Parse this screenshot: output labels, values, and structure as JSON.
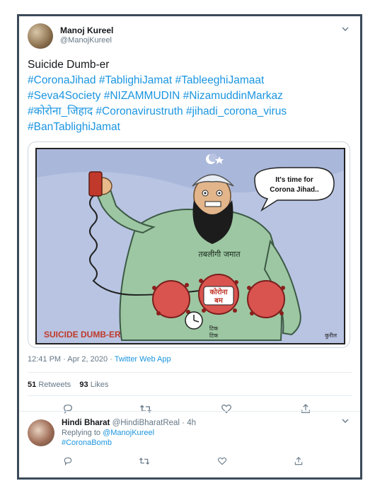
{
  "tweet": {
    "author_name": "Manoj Kureel",
    "author_handle": "@ManojKureel",
    "text_line1": "Suicide Dumb-er",
    "hashtag_lines": [
      "#CoronaJihad #TablighiJamat #TableeghiJamaat",
      "#Seva4Society #NIZAMMUDIN #NizamuddinMarkaz",
      "#कोरोना_जिहाद #Coronavirustruth #jihadi_corona_virus",
      "#BanTablighiJamat"
    ],
    "timestamp": "12:41 PM · Apr 2, 2020 · ",
    "source": "Twitter Web App",
    "retweets_count": "51",
    "retweets_label": "Retweets",
    "likes_count": "93",
    "likes_label": "Likes"
  },
  "cartoon": {
    "speech_bubble": "It's time for Corona Jihad..",
    "vest_label": "तबलीगी जमात",
    "bomb_label_line1": "कोरोना",
    "bomb_label_line2": "बम",
    "tick_line1": "टिक",
    "tick_line2": "टिक",
    "caption": "SUICIDE DUMB-ER",
    "signature": "कुरील"
  },
  "reply": {
    "author_name": "Hindi Bharat",
    "author_handle": "@HindiBharatReal · 4h",
    "replying_to_prefix": "Replying to ",
    "replying_to_handle": "@ManojKureel",
    "text": "#CoronaBomb"
  },
  "icons": [
    "chevron-down-icon",
    "reply-icon",
    "retweet-icon",
    "like-icon",
    "share-icon"
  ],
  "colors": {
    "link": "#1b95e0",
    "muted": "#657786",
    "frame": "#3b4a5a"
  }
}
